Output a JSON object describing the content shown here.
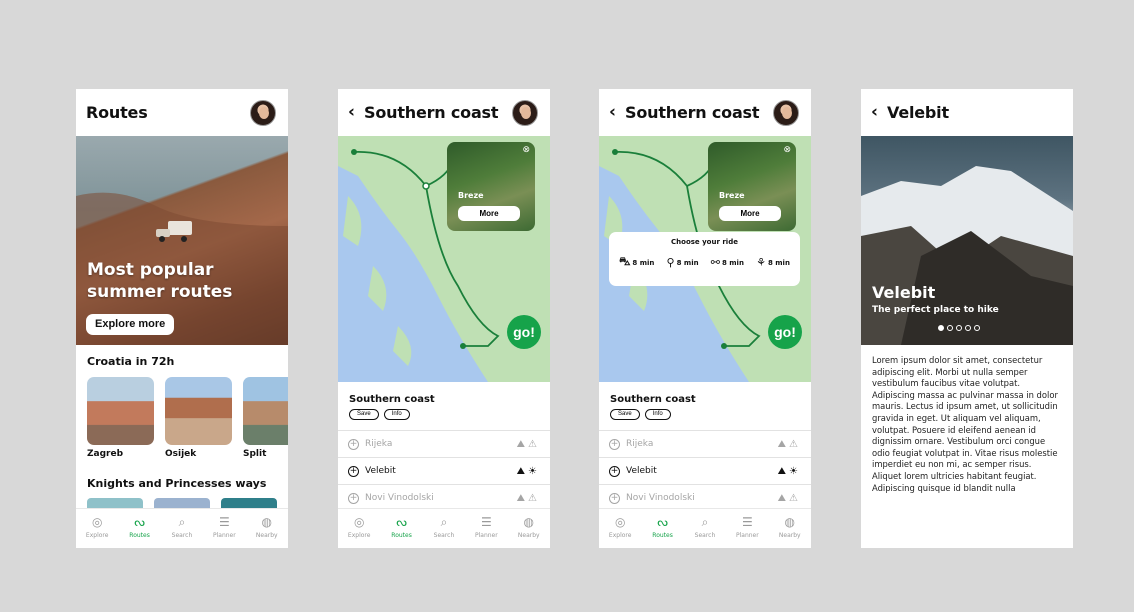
{
  "brand_color": "#16a34a",
  "tabs": [
    {
      "label": "Explore",
      "icon": "compass-icon",
      "glyph": "◎"
    },
    {
      "label": "Routes",
      "icon": "route-icon",
      "glyph": "ᔓ"
    },
    {
      "label": "Search",
      "icon": "search-icon",
      "glyph": "⌕"
    },
    {
      "label": "Planner",
      "icon": "list-icon",
      "glyph": "☰"
    },
    {
      "label": "Nearby",
      "icon": "location-icon",
      "glyph": "◍"
    }
  ],
  "screen1": {
    "title": "Routes",
    "hero_title_line1": "Most popular",
    "hero_title_line2": "summer routes",
    "hero_button": "Explore more",
    "section1": "Croatia in 72h",
    "cards": [
      "Zagreb",
      "Osijek",
      "Split"
    ],
    "section2": "Knights and Princesses ways",
    "active_tab": "Routes"
  },
  "map_screen": {
    "title": "Southern coast",
    "popup_place": "Breze",
    "popup_button": "More",
    "go_button": "go!",
    "route_name": "Southern coast",
    "save_chip": "Save",
    "info_chip": "Info",
    "list": [
      {
        "name": "Rijeka",
        "dim": true
      },
      {
        "name": "Velebit",
        "dim": false
      },
      {
        "name": "Novi Vinodolski",
        "dim": true
      }
    ]
  },
  "ride": {
    "title": "Choose your ride",
    "options": [
      {
        "icon": "car-icon",
        "glyph": "🚗",
        "time": "8 min"
      },
      {
        "icon": "bike-icon",
        "glyph": "🚲",
        "time": "8 min"
      },
      {
        "icon": "scooter-icon",
        "glyph": "🛴",
        "time": "8 min"
      },
      {
        "icon": "walk-icon",
        "glyph": "🚶",
        "time": "8 min"
      }
    ]
  },
  "screen4": {
    "title": "Velebit",
    "hero_title": "Velebit",
    "hero_subtitle": "The perfect place to hike",
    "slides": 5,
    "active_slide": 1,
    "body": "Lorem ipsum dolor sit amet, consectetur adipiscing elit. Morbi ut nulla semper vestibulum faucibus vitae volutpat. Adipiscing massa ac pulvinar massa in dolor mauris. Lectus id ipsum amet, ut sollicitudin gravida in eget. Ut aliquam vel aliquam, volutpat. Posuere id eleifend aenean id dignissim ornare. Vestibulum orci congue odio feugiat volutpat in. Vitae risus molestie imperdiet eu non mi, ac semper risus. Aliquet lorem ultricies habitant feugiat. Adipiscing quisque id blandit nulla"
  }
}
